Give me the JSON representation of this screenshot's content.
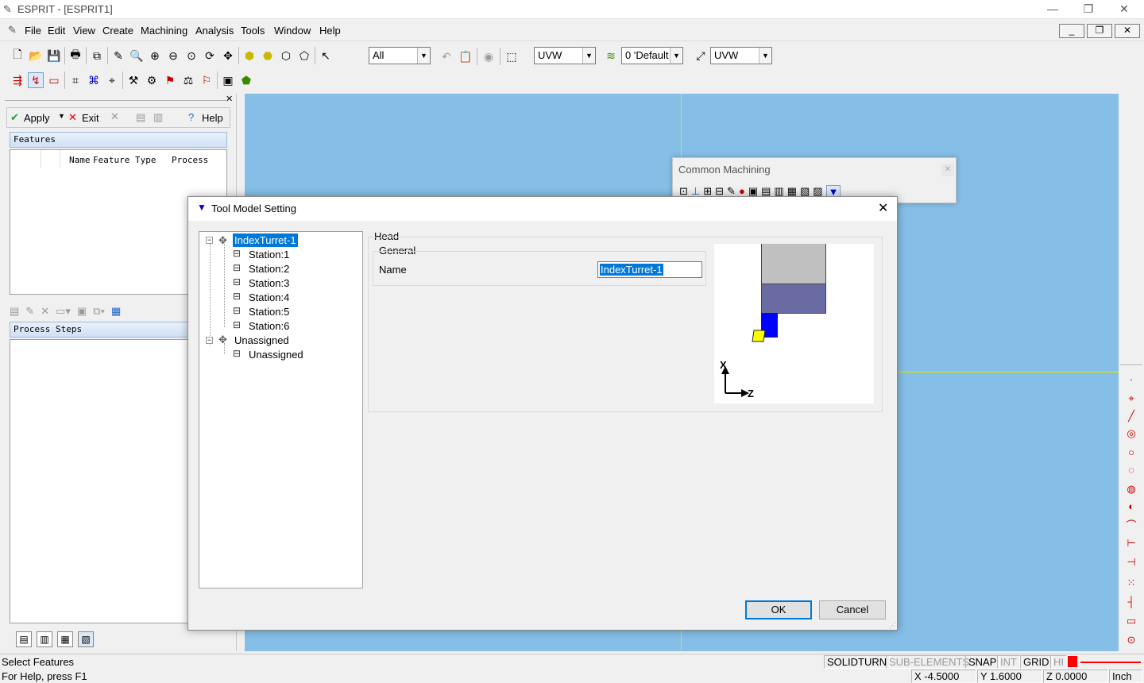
{
  "app": {
    "title": "ESPRIT - [ESPRIT1]"
  },
  "menu": [
    "File",
    "Edit",
    "View",
    "Create",
    "Machining",
    "Analysis",
    "Tools",
    "Window",
    "Help"
  ],
  "toolbar": {
    "filter_value": "All",
    "cs1_value": "UVW",
    "layer_value": "0 'Default",
    "cs2_value": "UVW"
  },
  "left_panel": {
    "apply": "Apply",
    "exit": "Exit",
    "help": "Help",
    "features_header": "Features",
    "features_columns": [
      "Name",
      "Feature Type",
      "Process"
    ],
    "process_steps_header": "Process Steps"
  },
  "common_machining": {
    "title": "Common Machining"
  },
  "dialog": {
    "title": "Tool Model Setting",
    "tree": {
      "root": "IndexTurret-1",
      "stations": [
        "Station:1",
        "Station:2",
        "Station:3",
        "Station:4",
        "Station:5",
        "Station:6"
      ],
      "unassigned_group": "Unassigned",
      "unassigned_child": "Unassigned"
    },
    "head_label": "Head",
    "general_label": "General",
    "name_label": "Name",
    "name_value": "IndexTurret-1",
    "axis_x": "X",
    "axis_z": "Z",
    "ok": "OK",
    "cancel": "Cancel"
  },
  "status": {
    "message": "Select Features",
    "help": "For Help, press F1",
    "solidturn": "SOLIDTURN",
    "sub_elements": "SUB-ELEMENTS",
    "snap": "SNAP",
    "int": "INT",
    "grid": "GRID",
    "hi": "HI",
    "x": "X -4.5000",
    "y": "Y 1.6000",
    "z": "Z 0.0000",
    "units": "Inch"
  },
  "colors": {
    "viewport": "#85bee6",
    "selection": "#0078d7",
    "tool_gray": "#c0c0c0",
    "tool_slate": "#6b6ba3",
    "tool_blue": "#0000ff",
    "tool_insert": "#ffff00"
  }
}
